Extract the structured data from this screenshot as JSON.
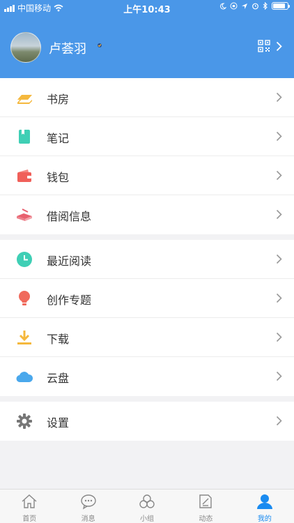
{
  "status_bar": {
    "carrier": "中国移动",
    "time": "上午10:43",
    "battery_level": 0.85
  },
  "profile": {
    "name": "卢荟羽"
  },
  "menu_sections": [
    [
      {
        "label": "书房",
        "icon": "bookshelf-icon",
        "color": "#f5b83d"
      },
      {
        "label": "笔记",
        "icon": "note-icon",
        "color": "#3fcfb5"
      },
      {
        "label": "钱包",
        "icon": "wallet-icon",
        "color": "#f0605a"
      },
      {
        "label": "借阅信息",
        "icon": "borrow-book-icon",
        "color": "#e8606e"
      }
    ],
    [
      {
        "label": "最近阅读",
        "icon": "clock-icon",
        "color": "#3fcfb5"
      },
      {
        "label": "创作专题",
        "icon": "lightbulb-icon",
        "color": "#f06a5c"
      },
      {
        "label": "下载",
        "icon": "download-icon",
        "color": "#f5b83d"
      },
      {
        "label": "云盘",
        "icon": "cloud-icon",
        "color": "#4aa8ec"
      }
    ],
    [
      {
        "label": "设置",
        "icon": "gear-icon",
        "color": "#777777"
      }
    ]
  ],
  "tabbar": {
    "active_color": "#1a8bf0",
    "tabs": [
      {
        "label": "首页",
        "icon": "home-icon"
      },
      {
        "label": "消息",
        "icon": "message-icon"
      },
      {
        "label": "小组",
        "icon": "group-icon"
      },
      {
        "label": "动态",
        "icon": "feed-icon"
      },
      {
        "label": "我的",
        "icon": "profile-icon",
        "active": true
      }
    ]
  }
}
